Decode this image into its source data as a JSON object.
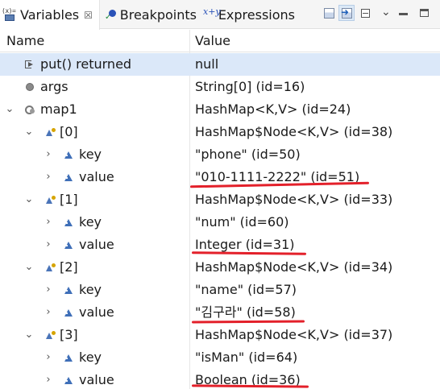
{
  "tabs": [
    {
      "label": "Variables",
      "close": "☒"
    },
    {
      "label": "Breakpoints"
    },
    {
      "label": "Expressions"
    }
  ],
  "icons": {
    "variables_tab": "variables-view-icon",
    "breakpoints_tab": "breakpoint-icon",
    "expressions_tab": "expression-icon",
    "toolbar": [
      "show-type-names-icon",
      "show-logical-structure-icon",
      "collapse-all-icon",
      "view-menu-icon",
      "minimize-icon",
      "maximize-icon"
    ]
  },
  "tab_variables_glyph": "(x)=",
  "tab_expressions_glyph": "x+y",
  "header": {
    "name": "Name",
    "value": "Value"
  },
  "colors": {
    "selection": "#dbe8f9",
    "underline": "#e3202a"
  },
  "rows": [
    {
      "name": "put() returned",
      "value": "null",
      "icon": "method-return-icon",
      "twisty": ""
    },
    {
      "name": "args",
      "value": "String[0]  (id=16)",
      "icon": "local-variable-icon",
      "twisty": ""
    },
    {
      "name": "map1",
      "value": "HashMap<K,V>  (id=24)",
      "icon": "local-variable-icon",
      "twisty": "⌄"
    },
    {
      "name": "[0]",
      "value": "HashMap$Node<K,V>  (id=38)",
      "icon": "field-icon",
      "twisty": "⌄"
    },
    {
      "name": "key",
      "value": "\"phone\" (id=50)",
      "icon": "field-icon",
      "twisty": "›"
    },
    {
      "name": "value",
      "value": "\"010-1111-2222\" (id=51)",
      "icon": "field-icon",
      "twisty": "›"
    },
    {
      "name": "[1]",
      "value": "HashMap$Node<K,V>  (id=33)",
      "icon": "field-icon",
      "twisty": "⌄"
    },
    {
      "name": "key",
      "value": "\"num\" (id=60)",
      "icon": "field-icon",
      "twisty": "›"
    },
    {
      "name": "value",
      "value": "Integer  (id=31)",
      "icon": "field-icon",
      "twisty": "›"
    },
    {
      "name": "[2]",
      "value": "HashMap$Node<K,V>  (id=34)",
      "icon": "field-icon",
      "twisty": "⌄"
    },
    {
      "name": "key",
      "value": "\"name\" (id=57)",
      "icon": "field-icon",
      "twisty": "›"
    },
    {
      "name": "value",
      "value": "\"김구라\" (id=58)",
      "icon": "field-icon",
      "twisty": "›"
    },
    {
      "name": "[3]",
      "value": "HashMap$Node<K,V>  (id=37)",
      "icon": "field-icon",
      "twisty": "⌄"
    },
    {
      "name": "key",
      "value": "\"isMan\" (id=64)",
      "icon": "field-icon",
      "twisty": "›"
    },
    {
      "name": "value",
      "value": "Boolean  (id=36)",
      "icon": "field-icon",
      "twisty": "›"
    }
  ]
}
